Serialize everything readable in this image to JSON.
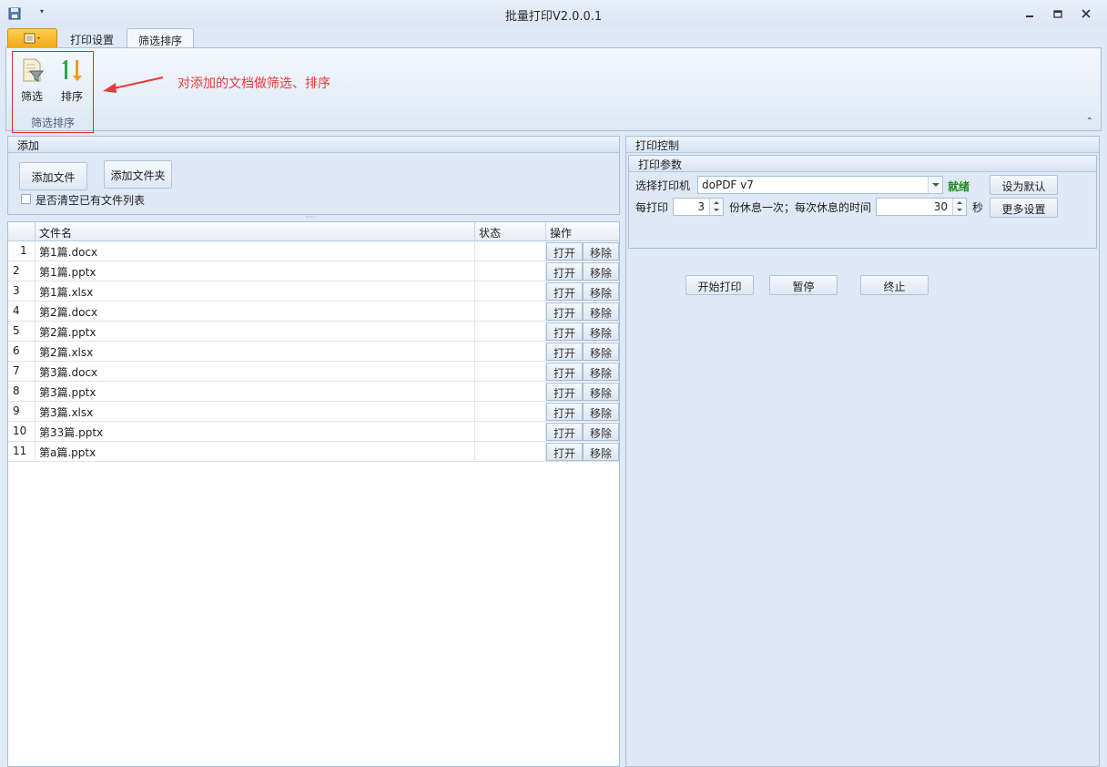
{
  "window": {
    "title": "批量打印V2.0.0.1",
    "qa_menu_glyph": "▾",
    "icons": [
      "save-icon",
      "minimize-icon",
      "restore-icon",
      "close-icon"
    ]
  },
  "tabs": [
    {
      "label": "打印设置",
      "active": false
    },
    {
      "label": "筛选排序",
      "active": true
    }
  ],
  "ribbon": {
    "group_label": "筛选排序",
    "buttons": [
      {
        "label": "筛选",
        "icon": "filter-icon"
      },
      {
        "label": "排序",
        "icon": "sort-icon"
      }
    ],
    "annotation": "对添加的文档做筛选、排序",
    "collapse_glyph": "⌃"
  },
  "add_panel": {
    "header": "添加",
    "add_file_label": "添加文件",
    "add_folder_label": "添加文件夹",
    "clear_list_label": "是否清空已有文件列表",
    "clear_list_checked": false,
    "splitter_glyph": "····"
  },
  "grid": {
    "columns": {
      "name": "文件名",
      "state": "状态",
      "action": "操作"
    },
    "open_label": "打开",
    "remove_label": "移除",
    "rows": [
      {
        "index": "1",
        "name": "第1篇.docx",
        "state": "",
        "selected": true
      },
      {
        "index": "2",
        "name": "第1篇.pptx",
        "state": ""
      },
      {
        "index": "3",
        "name": "第1篇.xlsx",
        "state": ""
      },
      {
        "index": "4",
        "name": "第2篇.docx",
        "state": ""
      },
      {
        "index": "5",
        "name": "第2篇.pptx",
        "state": ""
      },
      {
        "index": "6",
        "name": "第2篇.xlsx",
        "state": ""
      },
      {
        "index": "7",
        "name": "第3篇.docx",
        "state": ""
      },
      {
        "index": "8",
        "name": "第3篇.pptx",
        "state": ""
      },
      {
        "index": "9",
        "name": "第3篇.xlsx",
        "state": ""
      },
      {
        "index": "10",
        "name": "第33篇.pptx",
        "state": ""
      },
      {
        "index": "11",
        "name": "第a篇.pptx",
        "state": ""
      }
    ]
  },
  "print_control": {
    "header": "打印控制",
    "params_header": "打印参数",
    "printer_label": "选择打印机",
    "printer_value": "doPDF v7",
    "printer_status": "就绪",
    "set_default_label": "设为默认",
    "per_print_label": "每打印",
    "per_print_value": "3",
    "rest_label": "份休息一次；每次休息的时间",
    "rest_value": "30",
    "seconds_label": "秒",
    "more_settings_label": "更多设置",
    "start_label": "开始打印",
    "pause_label": "暂停",
    "stop_label": "终止"
  },
  "colors": {
    "accent_orange": "#f2a516",
    "annotation_red": "#e83a3a",
    "status_green": "#1e8a1e",
    "panel_bg": "#dfe8f5"
  }
}
